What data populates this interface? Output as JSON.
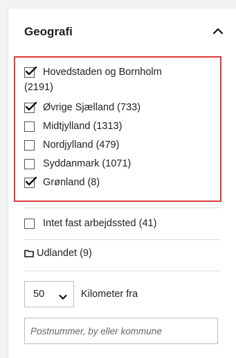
{
  "filter": {
    "title": "Geografi",
    "collapse_icon": "chevron-up-icon"
  },
  "regions": [
    {
      "label_line1": "Hovedstaden og Bornholm",
      "label_line2": "(2191)",
      "checked": true
    },
    {
      "label": "Øvrige Sjælland (733)",
      "checked": true
    },
    {
      "label": "Midtjylland (1313)",
      "checked": false
    },
    {
      "label": "Nordjylland (479)",
      "checked": false
    },
    {
      "label": "Syddanmark (1071)",
      "checked": false
    },
    {
      "label": "Grønland (8)",
      "checked": true
    }
  ],
  "other": {
    "no_fixed_workplace": {
      "label": "Intet fast arbejdssted (41)",
      "checked": false
    },
    "abroad": {
      "label": "Udlandet (9)",
      "icon": "folder-icon"
    }
  },
  "distance": {
    "selected": "50",
    "label": "Kilometer fra"
  },
  "location_input": {
    "placeholder": "Postnummer, by eller kommune",
    "value": ""
  },
  "colors": {
    "highlight_border": "#e03a3a",
    "background": "#f3f3f3"
  }
}
